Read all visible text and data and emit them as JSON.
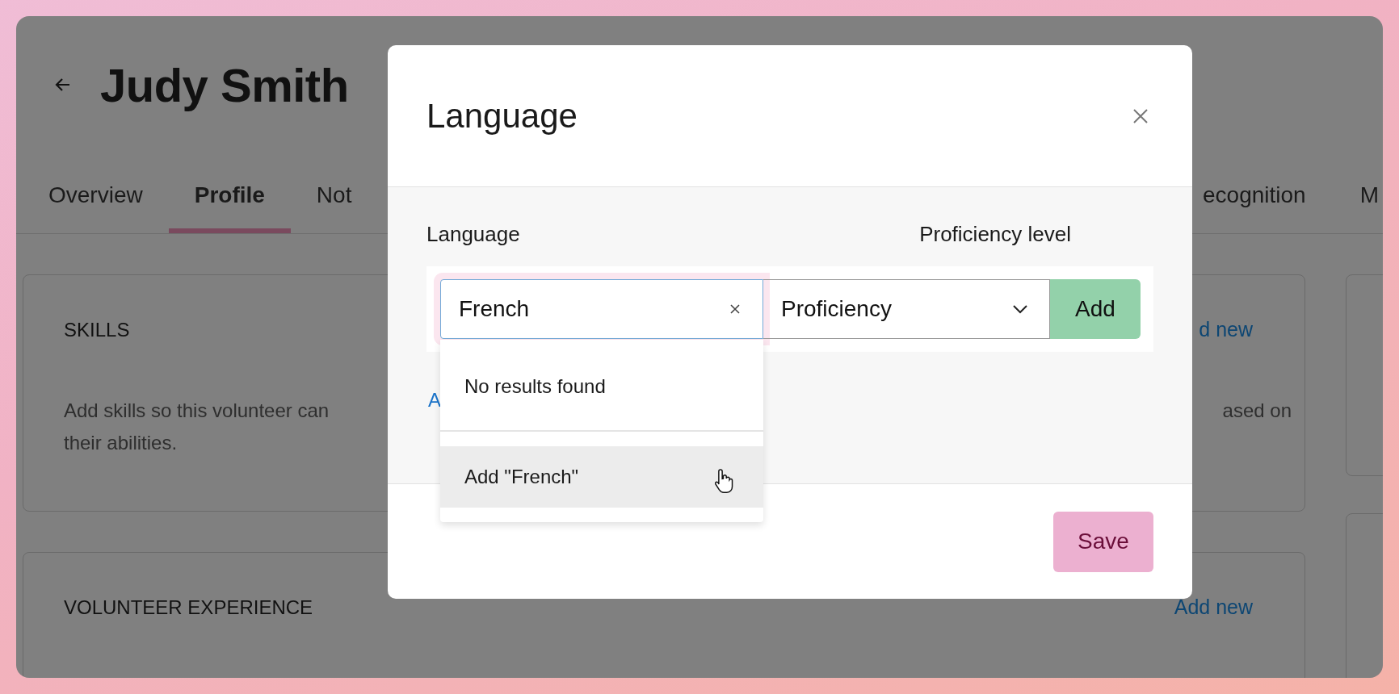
{
  "page": {
    "title": "Judy Smith",
    "tabs": [
      {
        "label": "Overview",
        "selected": false
      },
      {
        "label": "Profile",
        "selected": true
      },
      {
        "label": "Not",
        "selected": false
      }
    ],
    "right_tabs": [
      {
        "label": "ecognition",
        "selected": false
      },
      {
        "label": "M",
        "selected": false
      }
    ],
    "cards": [
      {
        "title": "SKILLS",
        "action": "d new",
        "text_left": [
          "Add skills so this volunteer can",
          "their abilities."
        ],
        "text_right": "ased on"
      },
      {
        "title": "VOLUNTEER EXPERIENCE",
        "action": "Add new"
      }
    ]
  },
  "dialog": {
    "title": "Language",
    "language_label": "Language",
    "proficiency_label": "Proficiency level",
    "language_input": {
      "value": "French"
    },
    "proficiency_select": {
      "value": "Proficiency"
    },
    "add_button": "Add",
    "link": "A",
    "dropdown": [
      {
        "kind": "message",
        "label": "No results found",
        "selected": false
      },
      {
        "kind": "option",
        "label": "Add \"French\"",
        "selected": true
      }
    ],
    "save_button": "Save"
  }
}
